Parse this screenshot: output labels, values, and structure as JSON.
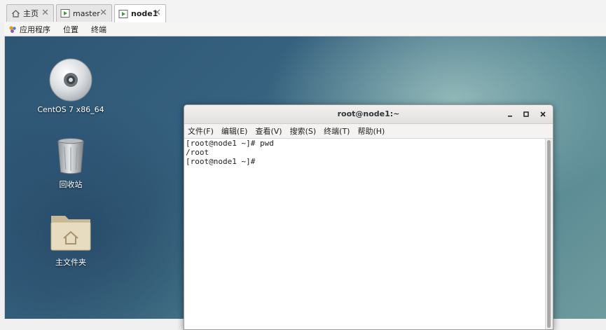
{
  "tabs": [
    {
      "label": "主页",
      "icon": "home-icon",
      "active": false
    },
    {
      "label": "master",
      "icon": "vm-icon",
      "active": false
    },
    {
      "label": "node1",
      "icon": "vm-icon",
      "active": true
    }
  ],
  "gnome_bar": {
    "applications": "应用程序",
    "places": "位置",
    "terminal": "终端"
  },
  "desktop_icons": [
    {
      "label": "CentOS 7 x86_64",
      "icon": "disc-icon"
    },
    {
      "label": "回收站",
      "icon": "trash-icon"
    },
    {
      "label": "主文件夹",
      "icon": "home-folder-icon"
    }
  ],
  "terminal": {
    "title": "root@node1:~",
    "menu": [
      "文件(F)",
      "编辑(E)",
      "查看(V)",
      "搜索(S)",
      "终端(T)",
      "帮助(H)"
    ],
    "lines": [
      "[root@node1 ~]# pwd",
      "/root",
      "[root@node1 ~]#"
    ]
  },
  "colors": {
    "desktop_accent": "#36627f",
    "window_bg": "#ffffff"
  }
}
